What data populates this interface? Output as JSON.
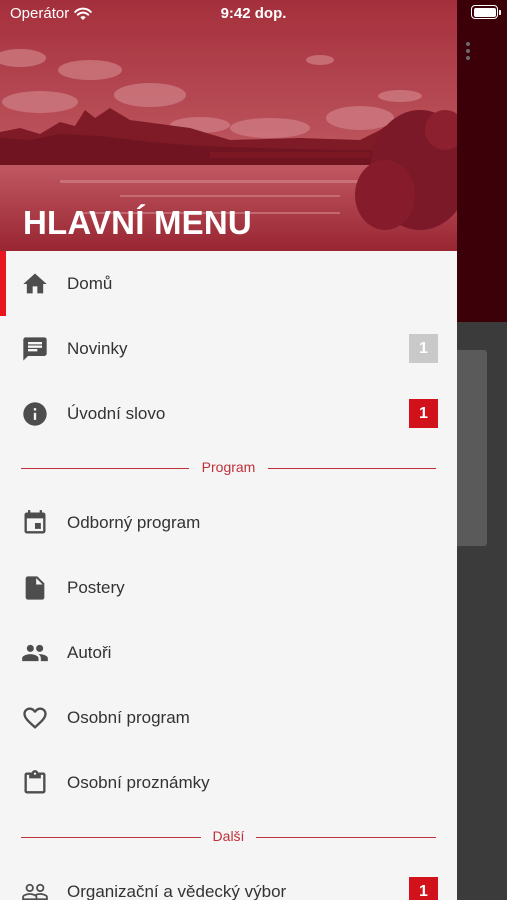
{
  "status_bar": {
    "carrier": "Operátor",
    "time": "9:42 dop."
  },
  "drawer": {
    "header_title": "HLAVNÍ MENU",
    "items_top": [
      {
        "label": "Domů",
        "icon": "home-icon",
        "active": true,
        "badge": null
      },
      {
        "label": "Novinky",
        "icon": "message-icon",
        "active": false,
        "badge": "1",
        "badge_color": "#c9c9c9"
      },
      {
        "label": "Úvodní slovo",
        "icon": "info-icon",
        "active": false,
        "badge": "1",
        "badge_color": "#d1121b"
      }
    ],
    "section_program": "Program",
    "items_program": [
      {
        "label": "Odborný program",
        "icon": "calendar-icon"
      },
      {
        "label": "Postery",
        "icon": "document-icon"
      },
      {
        "label": "Autoři",
        "icon": "people-icon"
      },
      {
        "label": "Osobní program",
        "icon": "heart-icon"
      },
      {
        "label": "Osobní proznámky",
        "icon": "clipboard-icon"
      }
    ],
    "section_other": "Další",
    "items_other": [
      {
        "label": "Organizační a vědecký výbor",
        "icon": "people-outline-icon",
        "badge": "1",
        "badge_color": "#d1121b"
      }
    ]
  },
  "colors": {
    "accent": "#d1121b",
    "header_tint": "#8c1f2c",
    "section_line": "#c0303a",
    "drawer_bg": "#f5f5f5"
  }
}
